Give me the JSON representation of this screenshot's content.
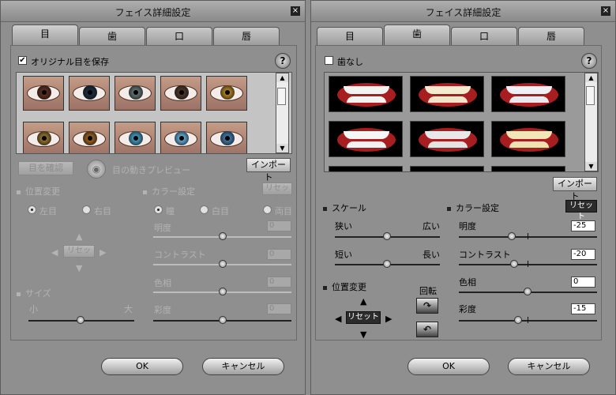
{
  "left": {
    "title": "フェイス詳細設定",
    "close": "×",
    "tabs": [
      "目",
      "歯",
      "口",
      "唇"
    ],
    "keep_eye_label": "オリジナル目を保存",
    "keep_eye_checked": true,
    "help": "?",
    "check_eye_btn": "目を確認",
    "preview_label": "目の動きプレビュー",
    "import_btn": "インポート",
    "position_heading": "位置変更",
    "color_heading": "カラー設定",
    "color_reset": "リセット",
    "radio_left": "左目",
    "radio_right": "右目",
    "radio_pupil": "瞳",
    "radio_white": "白目",
    "radio_both": "両目",
    "pad_reset": "リセット",
    "size_heading": "サイズ",
    "size_small": "小",
    "size_large": "大",
    "brightness": "明度",
    "contrast": "コントラスト",
    "hue": "色相",
    "saturation": "彩度",
    "brightness_val": "0",
    "contrast_val": "0",
    "hue_val": "0",
    "saturation_val": "0",
    "ok": "OK",
    "cancel": "キャンセル"
  },
  "right": {
    "title": "フェイス詳細設定",
    "close": "×",
    "tabs": [
      "目",
      "歯",
      "口",
      "唇"
    ],
    "no_teeth_label": "歯なし",
    "no_teeth_checked": false,
    "help": "?",
    "import_btn": "インポート",
    "scale_heading": "スケール",
    "narrow": "狭い",
    "wide": "広い",
    "short": "短い",
    "long": "長い",
    "color_heading": "カラー設定",
    "color_reset": "リセット",
    "brightness": "明度",
    "brightness_val": "-25",
    "contrast": "コントラスト",
    "contrast_val": "-20",
    "hue": "色相",
    "hue_val": "0",
    "saturation": "彩度",
    "saturation_val": "-15",
    "position_heading": "位置変更",
    "rotate": "回転",
    "pad_reset": "リセット",
    "ok": "OK",
    "cancel": "キャンセル"
  },
  "colors": {
    "iris": [
      "#5a2b1f",
      "#1b2a3a",
      "#5d6b6a",
      "#4a3426",
      "#a57a22",
      "#8a6a2a",
      "#8d5a1f",
      "#3f8fb0",
      "#5d9ec4",
      "#3f6f9a"
    ],
    "upper_teeth": [
      "#f2f2f0",
      "#f4ead0",
      "#eef0f5",
      "#f6f6f6",
      "#e8e8e8",
      "#f2e6b8",
      "#f0f0f0",
      "#f4f4f4",
      "#f0f0f0"
    ],
    "lower_teeth": [
      "#f2f2f0",
      "#f0e5c8",
      "#e8eaf0",
      "#f2f2f2",
      "#e4e4e4",
      "#efe2b2",
      "#f0f0f0",
      "#f4f4f4",
      "#f0f0f0"
    ]
  }
}
